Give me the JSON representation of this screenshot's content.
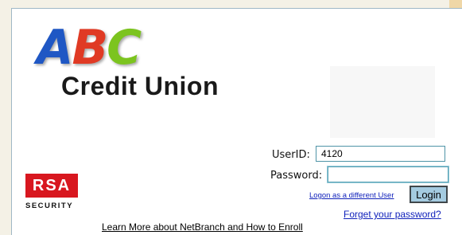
{
  "logo": {
    "letters": [
      "A",
      "B",
      "C"
    ],
    "letter_colors": [
      "#1f57c4",
      "#e03a24",
      "#7cc41f"
    ],
    "subtitle": "Credit Union"
  },
  "rsa": {
    "mark": "RSA",
    "caption": "SECURITY",
    "color": "#d8171f"
  },
  "form": {
    "userid_label": "UserID:",
    "userid_value": "4120",
    "password_label": "Password:",
    "password_value": "",
    "different_user_link": "Logon as a different User",
    "login_button": "Login",
    "forgot_link": "Forget your password?"
  },
  "footer": {
    "learn_link": "Learn More about NetBranch and How to Enroll"
  },
  "colors": {
    "link": "#1122bb",
    "button_fill": "#a4cbe0",
    "field_border": "#4f94a7"
  }
}
